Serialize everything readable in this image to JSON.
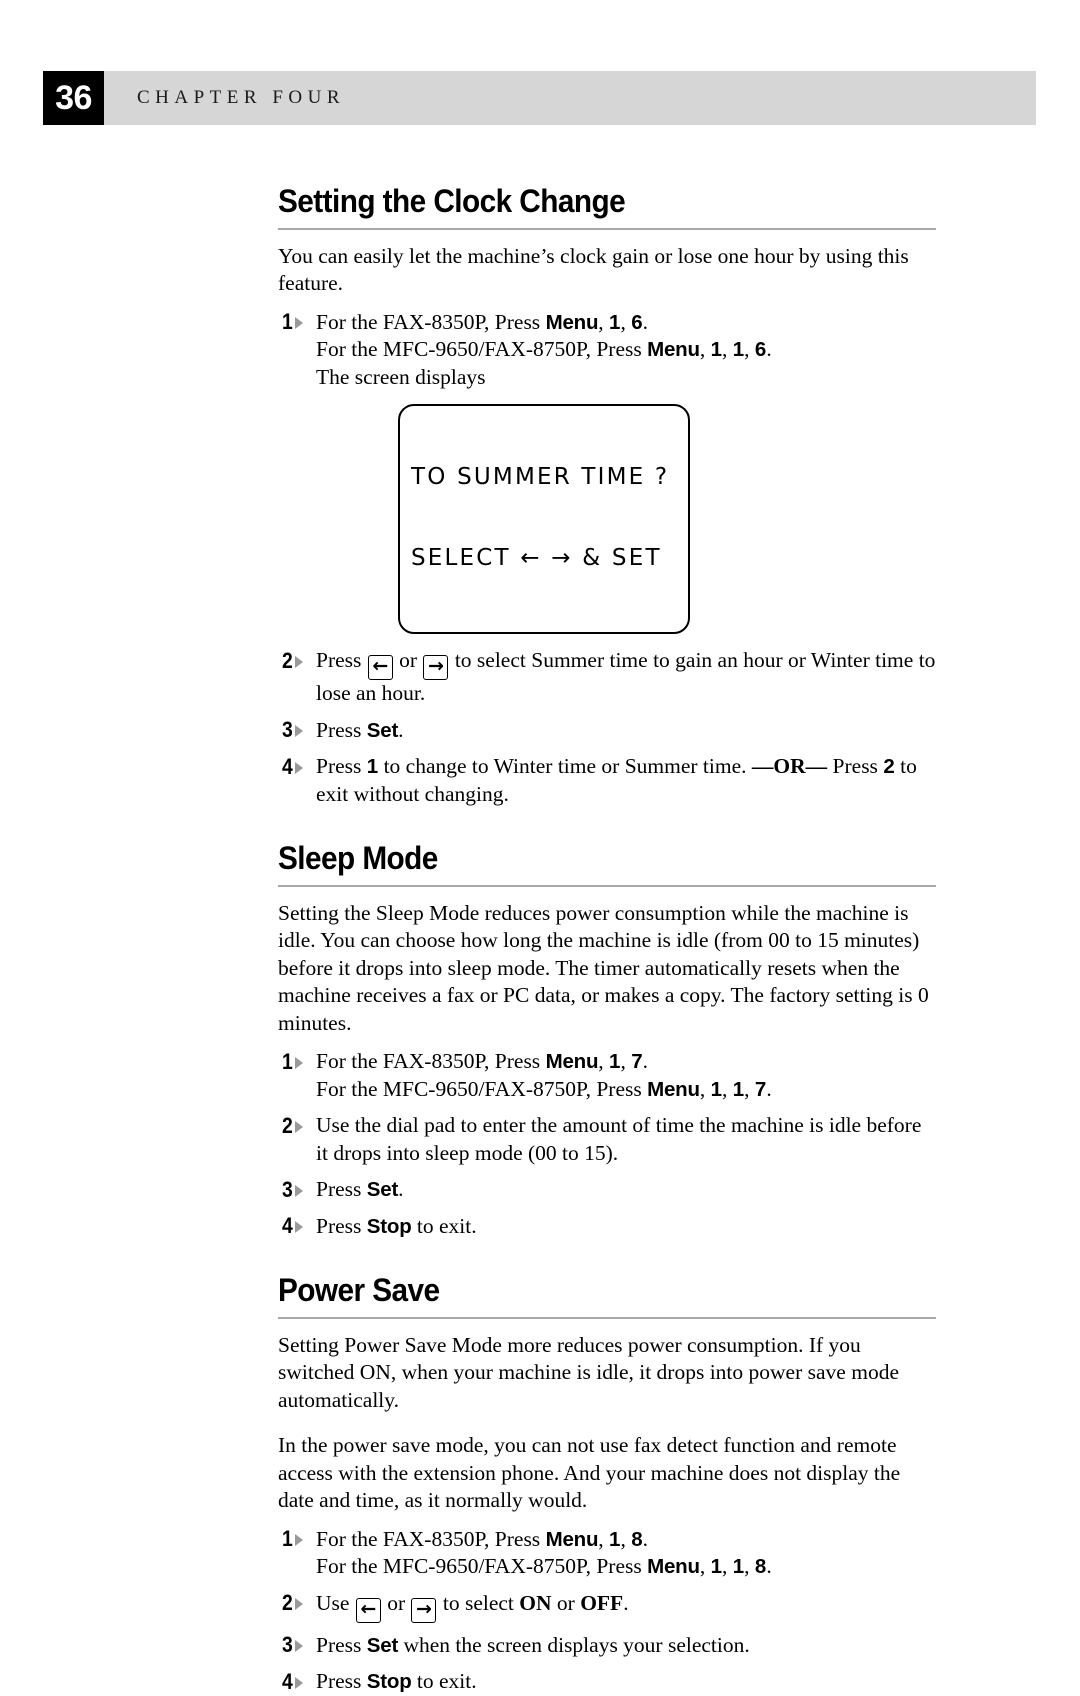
{
  "header": {
    "page_number": "36",
    "chapter_label": "CHAPTER FOUR"
  },
  "sections": [
    {
      "heading": "Setting the Clock Change",
      "intro": "You can easily let the machine’s clock gain or lose one hour by using this feature.",
      "steps": {
        "s1_num": "1",
        "s1_l1_a": "For the FAX-8350P, Press ",
        "s1_l1_menu": "Menu",
        "s1_l1_c1": ", ",
        "s1_l1_d1": "1",
        "s1_l1_c2": ", ",
        "s1_l1_d2": "6",
        "s1_l1_end": ".",
        "s1_l2_a": "For the MFC-9650/FAX-8750P, Press ",
        "s1_l2_menu": "Menu",
        "s1_l2_c1": ", ",
        "s1_l2_d1": "1",
        "s1_l2_c2": ", ",
        "s1_l2_d2": "1",
        "s1_l2_c3": ", ",
        "s1_l2_d3": "6",
        "s1_l2_end": ".",
        "s1_l3": "The screen displays",
        "s2_num": "2",
        "s2_a": "Press ",
        "s2_left": "←",
        "s2_or": " or ",
        "s2_right": "→",
        "s2_b": " to select Summer time to gain an hour or Winter time to lose an hour.",
        "s3_num": "3",
        "s3_a": "Press ",
        "s3_key": "Set",
        "s3_b": ".",
        "s4_num": "4",
        "s4_a": "Press ",
        "s4_d1": "1",
        "s4_b": " to change to Winter time or Summer time. ",
        "s4_or": "—OR—",
        "s4_c": " Press ",
        "s4_d2": "2",
        "s4_d": " to exit without changing."
      },
      "lcd": {
        "line1": "TO SUMMER TIME ?",
        "line2": "SELECT ← → & SET"
      }
    },
    {
      "heading": "Sleep Mode",
      "intro": "Setting the Sleep Mode reduces power consumption while the machine is idle.  You can choose how long the machine is idle (from 00 to 15 minutes) before it drops into sleep mode.  The timer automatically resets when the machine receives a fax or PC data, or makes a copy. The factory setting is 0 minutes.",
      "steps": {
        "s1_num": "1",
        "s1_l1_a": "For the FAX-8350P, Press ",
        "s1_l1_menu": "Menu",
        "s1_l1_c1": ", ",
        "s1_l1_d1": "1",
        "s1_l1_c2": ", ",
        "s1_l1_d2": "7",
        "s1_l1_end": ".",
        "s1_l2_a": "For the MFC-9650/FAX-8750P, Press ",
        "s1_l2_menu": "Menu",
        "s1_l2_c1": ", ",
        "s1_l2_d1": "1",
        "s1_l2_c2": ", ",
        "s1_l2_d2": "1",
        "s1_l2_c3": ", ",
        "s1_l2_d3": "7",
        "s1_l2_end": ".",
        "s2_num": "2",
        "s2_text": "Use the dial pad to enter the amount of time the machine is idle before it drops into sleep mode (00 to 15).",
        "s3_num": "3",
        "s3_a": "Press ",
        "s3_key": "Set",
        "s3_b": ".",
        "s4_num": "4",
        "s4_a": "Press ",
        "s4_key": "Stop",
        "s4_b": " to exit."
      }
    },
    {
      "heading": "Power Save",
      "intro": "Setting Power Save Mode more reduces power consumption. If you switched ON, when your machine is idle, it drops into power save mode automatically.",
      "intro2": "In the power save mode, you can not use fax detect function and remote access with the extension phone. And your machine does not display the date and time, as it normally would.",
      "steps": {
        "s1_num": "1",
        "s1_l1_a": "For the FAX-8350P, Press ",
        "s1_l1_menu": "Menu",
        "s1_l1_c1": ", ",
        "s1_l1_d1": "1",
        "s1_l1_c2": ", ",
        "s1_l1_d2": "8",
        "s1_l1_end": ".",
        "s1_l2_a": "For the MFC-9650/FAX-8750P, Press ",
        "s1_l2_menu": "Menu",
        "s1_l2_c1": ", ",
        "s1_l2_d1": "1",
        "s1_l2_c2": ", ",
        "s1_l2_d2": "1",
        "s1_l2_c3": ", ",
        "s1_l2_d3": "8",
        "s1_l2_end": ".",
        "s2_num": "2",
        "s2_a": "Use ",
        "s2_left": "←",
        "s2_or": " or ",
        "s2_right": "→",
        "s2_b": " to select ",
        "s2_on": "ON",
        "s2_c": " or ",
        "s2_off": "OFF",
        "s2_d": ".",
        "s3_num": "3",
        "s3_a": "Press ",
        "s3_key": "Set",
        "s3_b": " when the screen displays your selection.",
        "s4_num": "4",
        "s4_a": "Press ",
        "s4_key": "Stop",
        "s4_b": " to exit."
      }
    }
  ]
}
